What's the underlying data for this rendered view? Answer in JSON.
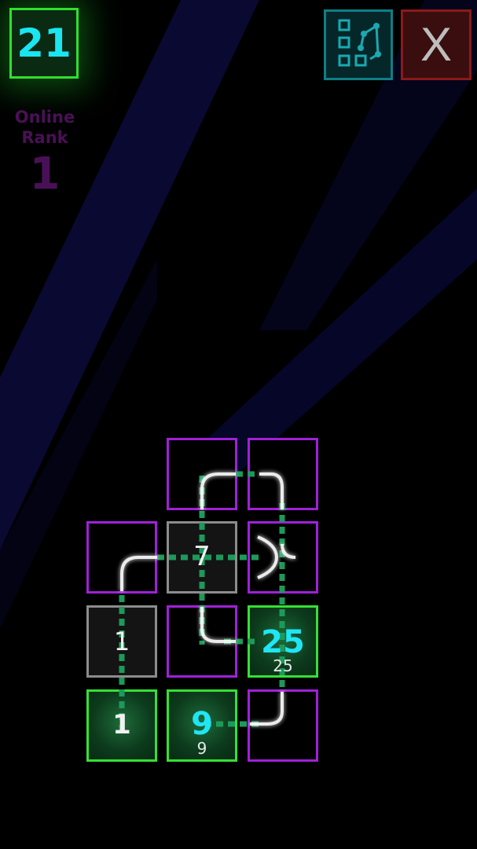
{
  "level": {
    "value": "21"
  },
  "online_rank": {
    "label_line1": "Online",
    "label_line2": "Rank",
    "value": "1"
  },
  "buttons": {
    "level_map_icon": "level-map-icon",
    "close_label": "X"
  },
  "board": {
    "tile_numbers": {
      "r1c2": "7",
      "r2c1": "1",
      "r2c3_main": "25",
      "r2c3_sub": "25",
      "r3c1": "1",
      "r3c2_main": "9",
      "r3c2_sub": "9"
    }
  },
  "colors": {
    "green": "#35e035",
    "purple": "#a020d8",
    "gray": "#8c8c8c",
    "cyan": "#1ee6f5",
    "teal": "#0e7f86",
    "red": "#8a1a1a"
  }
}
